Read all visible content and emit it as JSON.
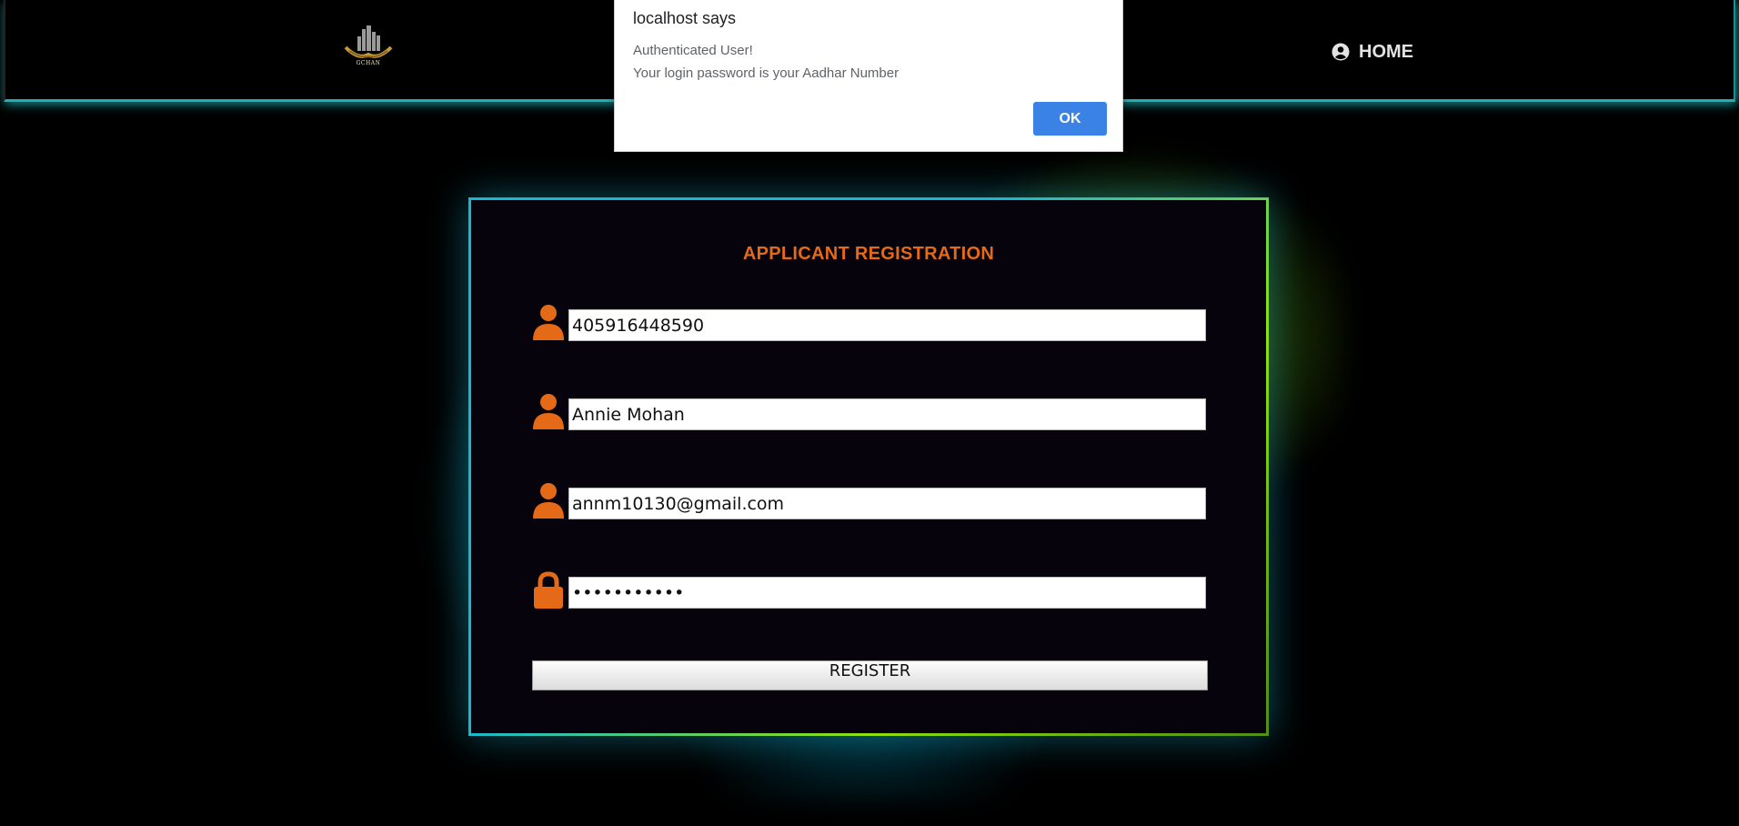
{
  "header": {
    "logo_text": "GCHAN",
    "home_label": "HOME"
  },
  "dialog": {
    "title": "localhost says",
    "message_line1": "Authenticated User!",
    "message_line2": "Your login password is your Aadhar Number",
    "ok_label": "OK"
  },
  "form": {
    "title": "APPLICANT REGISTRATION",
    "fields": [
      {
        "icon": "user-icon",
        "value": "405916448590"
      },
      {
        "icon": "user-icon",
        "value": "Annie Mohan"
      },
      {
        "icon": "user-icon",
        "value": "annm10130@gmail.com"
      },
      {
        "icon": "lock-icon",
        "value": "•••••••••••"
      }
    ],
    "register_label": "REGISTER"
  },
  "colors": {
    "accent_orange": "#e56a17",
    "glow_cyan": "#1ab8d0",
    "glow_green": "#8ce10f",
    "dialog_button": "#3b82e6"
  }
}
